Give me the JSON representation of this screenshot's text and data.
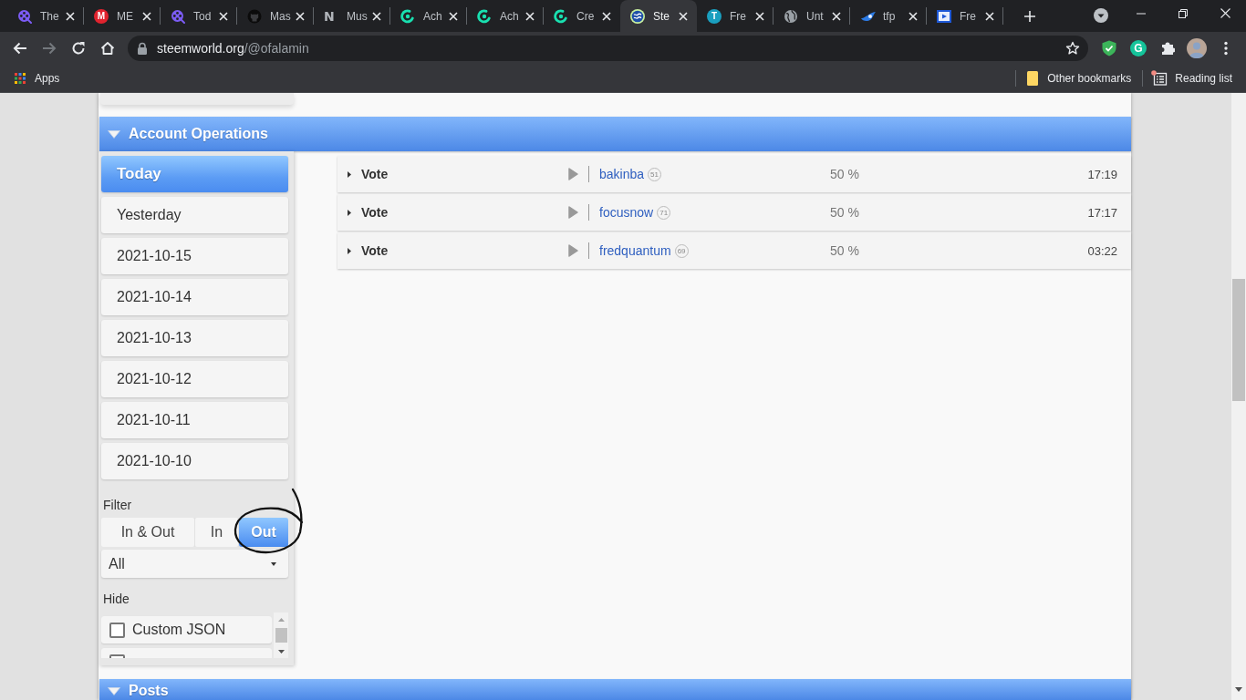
{
  "browser": {
    "tabs": [
      {
        "title": "The",
        "kind": "reel",
        "selected": false
      },
      {
        "title": "ME",
        "kind": "letter",
        "letter": "M",
        "color": "#e0232e",
        "selected": false
      },
      {
        "title": "Tod",
        "kind": "reel",
        "selected": false
      },
      {
        "title": "Mas",
        "kind": "cat",
        "selected": false
      },
      {
        "title": "Mus",
        "kind": "plain-letter",
        "letter": "N",
        "selected": false
      },
      {
        "title": "Ach",
        "kind": "swirl",
        "selected": false
      },
      {
        "title": "Ach",
        "kind": "swirl",
        "selected": false
      },
      {
        "title": "Cre",
        "kind": "swirl",
        "selected": false
      },
      {
        "title": "Ste",
        "kind": "steem",
        "selected": true
      },
      {
        "title": "Fre",
        "kind": "letter",
        "letter": "T",
        "color": "#1a9fbf",
        "selected": false
      },
      {
        "title": "Unt",
        "kind": "globe",
        "selected": false
      },
      {
        "title": "tfp",
        "kind": "swoosh",
        "selected": false
      },
      {
        "title": "Fre",
        "kind": "video",
        "selected": false
      }
    ],
    "toolbar": {
      "forward_disabled": true,
      "url": {
        "host": "steemworld.org",
        "path": "/@ofalamin"
      },
      "extensions": [
        {
          "kind": "shield"
        },
        {
          "kind": "letter",
          "letter": "G"
        },
        {
          "kind": "puzzle"
        },
        {
          "kind": "avatar"
        }
      ]
    },
    "bookmarks": {
      "apps": "Apps",
      "other": "Other bookmarks",
      "reading_list": "Reading list"
    }
  },
  "page": {
    "section": {
      "title": "Account Operations",
      "expanded": true
    },
    "days": [
      {
        "label": "Today",
        "selected": true
      },
      {
        "label": "Yesterday",
        "selected": false
      },
      {
        "label": "2021-10-15",
        "selected": false
      },
      {
        "label": "2021-10-14",
        "selected": false
      },
      {
        "label": "2021-10-13",
        "selected": false
      },
      {
        "label": "2021-10-12",
        "selected": false
      },
      {
        "label": "2021-10-11",
        "selected": false
      },
      {
        "label": "2021-10-10",
        "selected": false
      }
    ],
    "filter": {
      "label": "Filter",
      "directions": [
        {
          "label": "In & Out",
          "selected": false
        },
        {
          "label": "In",
          "selected": false
        },
        {
          "label": "Out",
          "selected": true
        }
      ],
      "type_select": {
        "value": "All"
      }
    },
    "hide": {
      "label": "Hide",
      "items": [
        {
          "label": "Custom JSON",
          "checked": false
        },
        {
          "checked": false
        }
      ]
    },
    "operations": [
      {
        "type": "Vote",
        "account": "bakinba",
        "reputation": "51",
        "weight": "50 %",
        "time": "17:19"
      },
      {
        "type": "Vote",
        "account": "focusnow",
        "reputation": "71",
        "weight": "50 %",
        "time": "17:17"
      },
      {
        "type": "Vote",
        "account": "fredquantum",
        "reputation": "69",
        "weight": "50 %",
        "time": "03:22"
      }
    ],
    "next_section": {
      "title": "Posts",
      "expanded": true
    }
  }
}
